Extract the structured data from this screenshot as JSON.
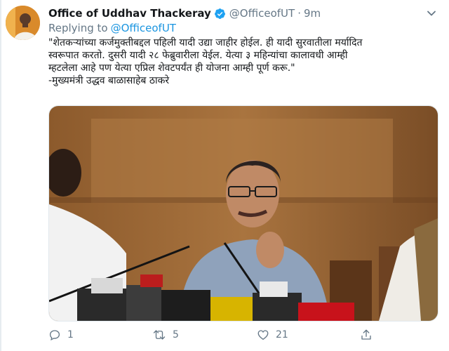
{
  "tweet": {
    "author_name": "Office of Uddhav Thackeray",
    "handle": "@OfficeofUT",
    "separator": "·",
    "timestamp": "9m",
    "replying_prefix": "Replying to",
    "replying_to": "@OfficeofUT",
    "text_lines": [
      "\"शेतकऱ्यांच्या कर्जमुक्तीबद्दल पहिली यादी उद्या जाहीर होईल. ही यादी सुरवातीला मर्यादित",
      "स्वरूपात करतो. दुसरी यादी २८ फेब्रुवारीला येईल. येत्या ३ महिन्यांचा कालावधी आम्ही",
      "म्हटलेला आहे पण येत्या एप्रिल शेवटपर्यंत ही योजना आम्ही पूर्ण करू.\"",
      "-मुख्यमंत्री उद्धव बाळासाहेब ठाकरे"
    ],
    "actions": {
      "reply_count": "1",
      "retweet_count": "5",
      "like_count": "21"
    },
    "icons": {
      "verified": "verified-badge-icon",
      "menu": "chevron-down-icon",
      "reply": "reply-icon",
      "retweet": "retweet-icon",
      "like": "heart-icon",
      "share": "share-icon"
    },
    "colors": {
      "link": "#1b95e0",
      "muted": "#657786",
      "verified": "#1da1f2"
    }
  }
}
